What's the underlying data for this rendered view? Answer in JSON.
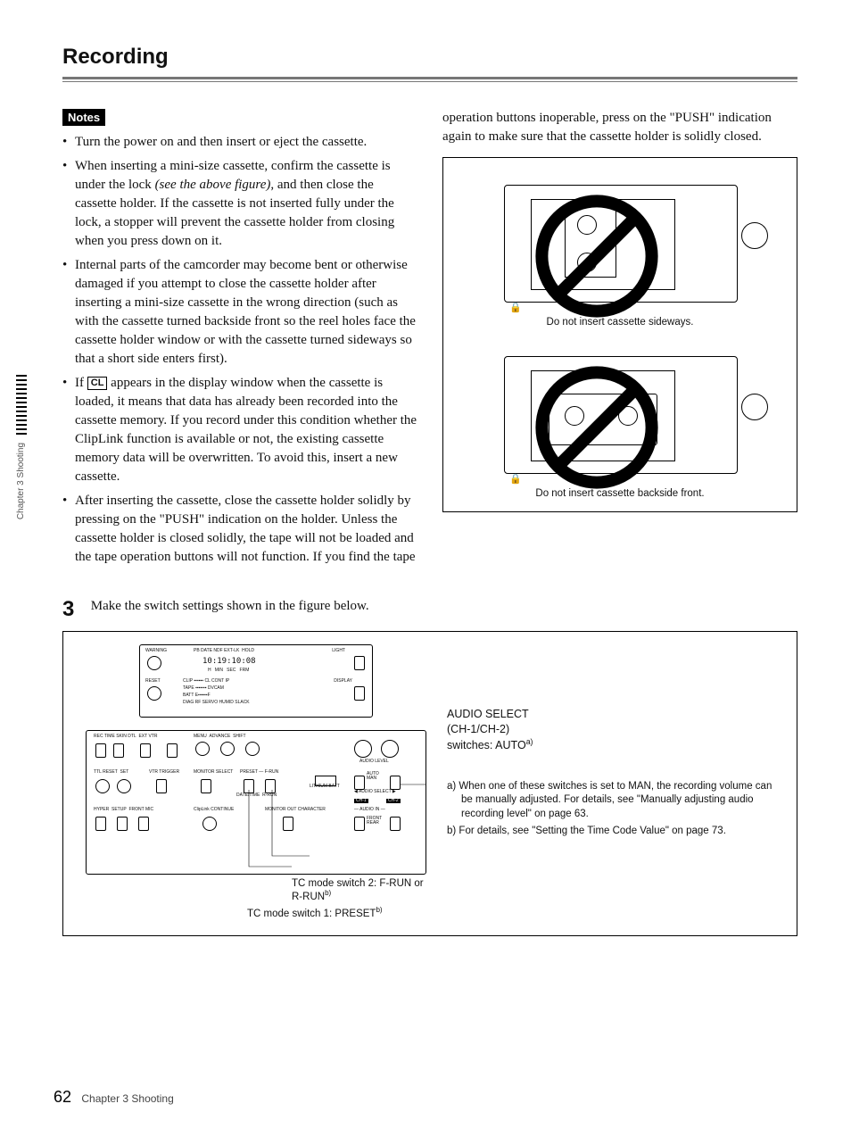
{
  "title": "Recording",
  "notes_label": "Notes",
  "bullets": {
    "b1": "Turn the power on and then insert or eject the cassette.",
    "b2_a": "When inserting a mini-size cassette, confirm the cassette is under the lock ",
    "b2_i": "(see the above figure)",
    "b2_b": ", and then close the cassette holder. If the cassette is not inserted fully under the lock, a stopper will prevent the cassette holder from closing when you press down on it.",
    "b3": "Internal parts of the camcorder may become bent or otherwise damaged if you attempt to close the cassette holder after inserting a mini-size cassette in the wrong direction (such as with the cassette turned backside front so the reel holes face the cassette holder window or with the cassette turned sideways so that a short side enters first).",
    "b4_a": "If ",
    "b4_cl": "CL",
    "b4_b": " appears in the display window when the cassette is loaded, it means that data has already been recorded into the cassette memory.  If you record under this condition whether the ClipLink function is available or not, the existing cassette memory data will be overwritten.  To avoid this, insert a new cassette.",
    "b5": "After inserting the cassette, close the cassette holder solidly by pressing on the \"PUSH\" indication on the holder.  Unless the cassette holder is closed solidly, the tape will not be loaded and the tape operation buttons will not function.  If you find the tape"
  },
  "right_para": "operation buttons inoperable, press on the \"PUSH\" indication again to make sure that the cassette holder is solidly closed.",
  "fig": {
    "cap1": "Do not insert cassette sideways.",
    "cap2": "Do not insert cassette backside front."
  },
  "step": {
    "num": "3",
    "text": "Make the switch settings shown in the figure below."
  },
  "panel": {
    "audio_select_1": "AUDIO SELECT",
    "audio_select_2": "(CH-1/CH-2)",
    "audio_select_3_a": "switches: AUTO",
    "audio_select_3_sup": "a)",
    "tc2_a": "TC mode switch 2: F-RUN or R-RUN",
    "tc2_sup": "b)",
    "tc1_a": "TC mode switch 1: PRESET",
    "tc1_sup": "b)",
    "fn_a": "a) When one of these switches is set to MAN, the recording volume can be manually adjusted. For details, see \"Manually adjusting audio recording level\" on page 63.",
    "fn_b": "b) For details, see \"Setting the Time Code Value\" on page 73."
  },
  "chart_data": {
    "type": "table",
    "title": "Switch settings shown in the figure",
    "rows": [
      {
        "control": "AUDIO SELECT (CH-1/CH-2) switches",
        "setting": "AUTO",
        "note_ref": "a"
      },
      {
        "control": "TC mode switch 2",
        "setting": "F-RUN or R-RUN",
        "note_ref": "b"
      },
      {
        "control": "TC mode switch 1",
        "setting": "PRESET",
        "note_ref": "b"
      }
    ],
    "notes": {
      "a": "When one of these switches is set to MAN, the recording volume can be manually adjusted. For details, see \"Manually adjusting audio recording level\" on page 63.",
      "b": "For details, see \"Setting the Time Code Value\" on page 73."
    }
  },
  "footer": {
    "page": "62",
    "chapter": "Chapter 3  Shooting"
  },
  "sidebar": "Chapter 3  Shooting"
}
